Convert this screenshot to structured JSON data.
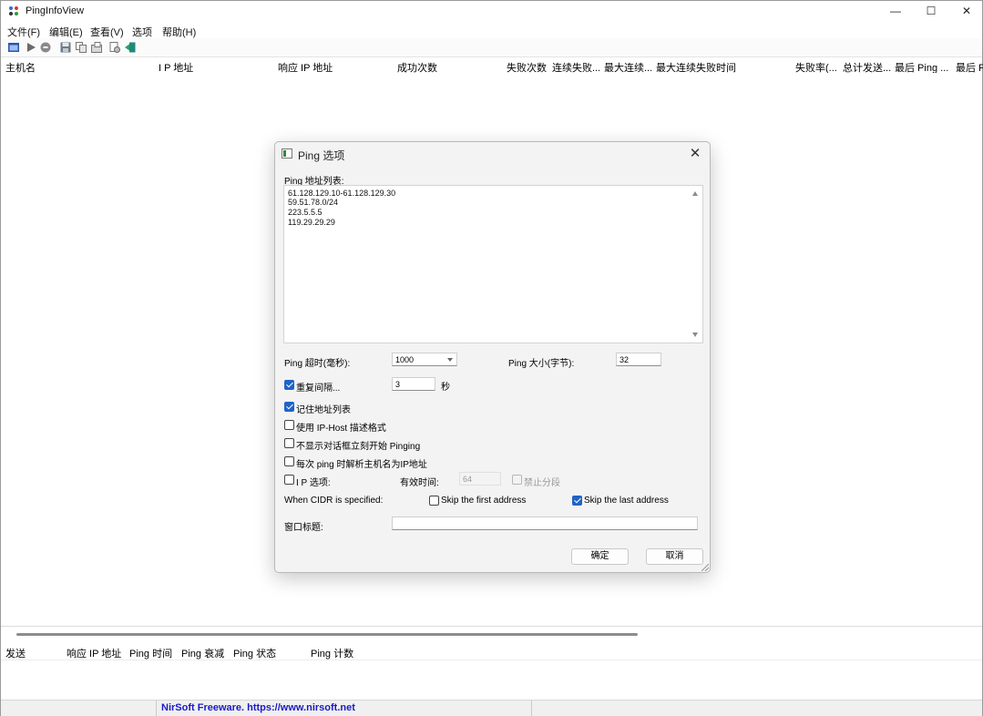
{
  "window": {
    "title": "PingInfoView",
    "minimize_glyph": "—",
    "maximize_glyph": "☐",
    "close_glyph": "✕"
  },
  "menu": [
    "文件(F)",
    "编辑(E)",
    "查看(V)",
    "选项",
    "帮助(H)"
  ],
  "toolbar_icons": [
    "window-icon",
    "play-icon",
    "stop-icon",
    "save-icon",
    "copy-icon",
    "properties-icon",
    "options-icon",
    "exit-icon"
  ],
  "columns_top": [
    "主机名",
    "I P 地址",
    "响应 IP 地址",
    "成功次数",
    "失败次数",
    "连续失败...",
    "最大连续...",
    "最大连续失败时间",
    "失败率(...",
    "总计发送...",
    "最后 Ping ...",
    "最后 P"
  ],
  "columns_bottom": [
    "发送",
    "响应 IP 地址",
    "Ping 时间",
    "Ping 衰减",
    "Ping 状态",
    "Ping 计数"
  ],
  "statusbar": {
    "link": "NirSoft Freeware. https://www.nirsoft.net"
  },
  "dialog": {
    "title": "Ping 选项",
    "close_glyph": "✕",
    "address_list_label": "Ping 地址列表:",
    "address_lines": [
      "61.128.129.10-61.128.129.30",
      "59.51.78.0/24",
      "223.5.5.5",
      "119.29.29.29"
    ],
    "timeout_label": "Ping 超时(毫秒):",
    "timeout_value": "1000",
    "size_label": "Ping 大小(字节):",
    "size_value": "32",
    "repeat_label": "重复间隔...",
    "repeat_value": "3",
    "repeat_unit": "秒",
    "remember_label": "记住地址列表",
    "iphost_label": "使用 IP-Host 描述格式",
    "nodialog_label": "不显示对话框立刻开始 Pinging",
    "resolve_label": "每次 ping 时解析主机名为IP地址",
    "ipopt_label": "I P 选项:",
    "ttl_label": "有效时间:",
    "ttl_value": "64",
    "nofrag_label": "禁止分段",
    "cidr_label": "When CIDR is specified:",
    "skip_first_label": "Skip the first address",
    "skip_last_label": "Skip the last address",
    "wintitle_label": "窗口标题:",
    "wintitle_value": "",
    "ok_label": "确定",
    "cancel_label": "取消",
    "checks": {
      "repeat": true,
      "remember": true,
      "iphost": false,
      "nodialog": false,
      "resolve": false,
      "ipopt": false,
      "nofrag": false,
      "skip_first": false,
      "skip_last": true
    }
  },
  "colors": {
    "accent": "#1f63c8",
    "link": "#1a1ac8"
  }
}
